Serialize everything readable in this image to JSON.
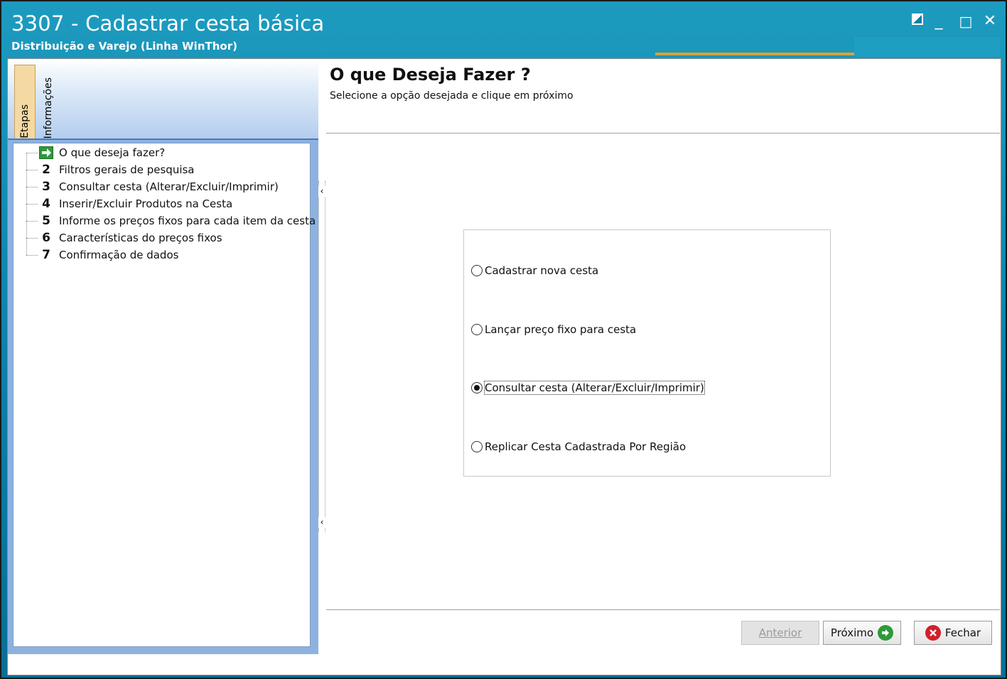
{
  "window": {
    "title": "3307 - Cadastrar cesta básica",
    "subtitle": "Distribuição e Varejo (Linha WinThor)",
    "controls": {
      "restore_icon": "restore-icon",
      "minimize_glyph": "_",
      "maximize_glyph": "□",
      "close_glyph": "✕"
    }
  },
  "sidebar": {
    "tabs": [
      {
        "label": "Etapas",
        "active": true
      },
      {
        "label": "Informações",
        "active": false
      }
    ],
    "steps": [
      {
        "num": "",
        "icon": "arrow-right-icon",
        "label": "O que deseja fazer?",
        "current": true
      },
      {
        "num": "2",
        "label": "Filtros gerais de pesquisa"
      },
      {
        "num": "3",
        "label": "Consultar cesta (Alterar/Excluir/Imprimir)"
      },
      {
        "num": "4",
        "label": "Inserir/Excluir Produtos na Cesta"
      },
      {
        "num": "5",
        "label": "Informe os preços fixos para cada item da cesta"
      },
      {
        "num": "6",
        "label": "Características do preços fixos"
      },
      {
        "num": "7",
        "label": "Confirmação de dados"
      }
    ]
  },
  "main": {
    "heading": "O que Deseja Fazer ?",
    "subheading": "Selecione a opção desejada e clique em próximo",
    "options": [
      {
        "label": "Cadastrar nova cesta",
        "checked": false
      },
      {
        "label": "Lançar preço fixo para cesta",
        "checked": false
      },
      {
        "label": "Consultar cesta (Alterar/Excluir/Imprimir)",
        "checked": true
      },
      {
        "label": "Replicar Cesta Cadastrada Por Região",
        "checked": false
      }
    ]
  },
  "footer": {
    "previous_label": "Anterior",
    "next_label": "Próximo",
    "close_label": "Fechar"
  },
  "colors": {
    "titlebar": "#0b7ea8",
    "accent": "#d9a33a",
    "active_tab": "#f5d9a3",
    "next_icon": "#2e9a3a",
    "close_icon": "#d0202a"
  }
}
